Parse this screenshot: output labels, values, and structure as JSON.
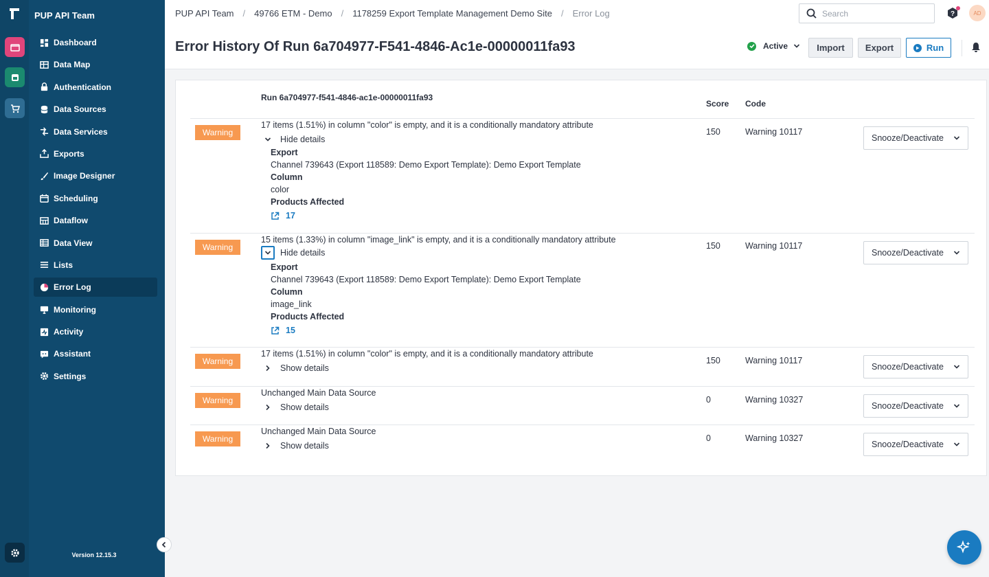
{
  "app": {
    "team": "PUP API Team",
    "version": "Version 12.15.3"
  },
  "sidebar": {
    "items": [
      {
        "label": "Dashboard",
        "icon": "dashboard-icon"
      },
      {
        "label": "Data Map",
        "icon": "data-map-icon"
      },
      {
        "label": "Authentication",
        "icon": "lock-icon"
      },
      {
        "label": "Data Sources",
        "icon": "database-icon"
      },
      {
        "label": "Data Services",
        "icon": "data-services-icon"
      },
      {
        "label": "Exports",
        "icon": "export-icon"
      },
      {
        "label": "Image Designer",
        "icon": "brush-icon"
      },
      {
        "label": "Scheduling",
        "icon": "calendar-icon"
      },
      {
        "label": "Dataflow",
        "icon": "dataflow-icon"
      },
      {
        "label": "Data View",
        "icon": "table-icon"
      },
      {
        "label": "Lists",
        "icon": "list-icon"
      },
      {
        "label": "Error Log",
        "icon": "error-log-icon",
        "active": true
      },
      {
        "label": "Monitoring",
        "icon": "monitor-icon"
      },
      {
        "label": "Activity",
        "icon": "activity-icon"
      },
      {
        "label": "Assistant",
        "icon": "assistant-icon"
      },
      {
        "label": "Settings",
        "icon": "gear-icon"
      }
    ]
  },
  "breadcrumb": [
    "PUP API Team",
    "49766 ETM - Demo",
    "1178259 Export Template Management Demo Site",
    "Error Log"
  ],
  "search": {
    "placeholder": "Search"
  },
  "user": {
    "initials": "AD"
  },
  "page": {
    "title": "Error History Of Run 6a704977-F541-4846-Ac1e-00000011fa93",
    "status": "Active",
    "import_label": "Import",
    "export_label": "Export",
    "run_label": "Run"
  },
  "table": {
    "run_label": "Run 6a704977-f541-4846-ac1e-00000011fa93",
    "score_header": "Score",
    "code_header": "Code",
    "rows": [
      {
        "badge": "Warning",
        "message": "17 items (1.51%) in column \"color\" is empty, and it is a conditionally mandatory attribute",
        "toggle": "Hide details",
        "export_label": "Export",
        "export_value": "Channel 739643 (Export 118589: Demo Export Template): Demo Export Template",
        "column_label": "Column",
        "column_value": "color",
        "affected_label": "Products Affected",
        "affected_value": "17",
        "score": "150",
        "code": "Warning 10117",
        "action": "Snooze/Deactivate"
      },
      {
        "badge": "Warning",
        "message": "15 items (1.33%) in column \"image_link\" is empty, and it is a conditionally mandatory attribute",
        "toggle": "Hide details",
        "export_label": "Export",
        "export_value": "Channel 739643 (Export 118589: Demo Export Template): Demo Export Template",
        "column_label": "Column",
        "column_value": "image_link",
        "affected_label": "Products Affected",
        "affected_value": "15",
        "score": "150",
        "code": "Warning 10117",
        "action": "Snooze/Deactivate"
      },
      {
        "badge": "Warning",
        "message": "17 items (1.51%) in column \"color\" is empty, and it is a conditionally mandatory attribute",
        "toggle": "Show details",
        "score": "150",
        "code": "Warning 10117",
        "action": "Snooze/Deactivate"
      },
      {
        "badge": "Warning",
        "message": "Unchanged Main Data Source",
        "toggle": "Show details",
        "score": "0",
        "code": "Warning 10327",
        "action": "Snooze/Deactivate"
      },
      {
        "badge": "Warning",
        "message": "Unchanged Main Data Source",
        "toggle": "Show details",
        "score": "0",
        "code": "Warning 10327",
        "action": "Snooze/Deactivate"
      }
    ]
  },
  "colors": {
    "warning": "#f79950",
    "accent": "#1a7bc1",
    "sidebar": "#104a6e",
    "rail": "#0f4566",
    "active_green": "#22a14a"
  }
}
